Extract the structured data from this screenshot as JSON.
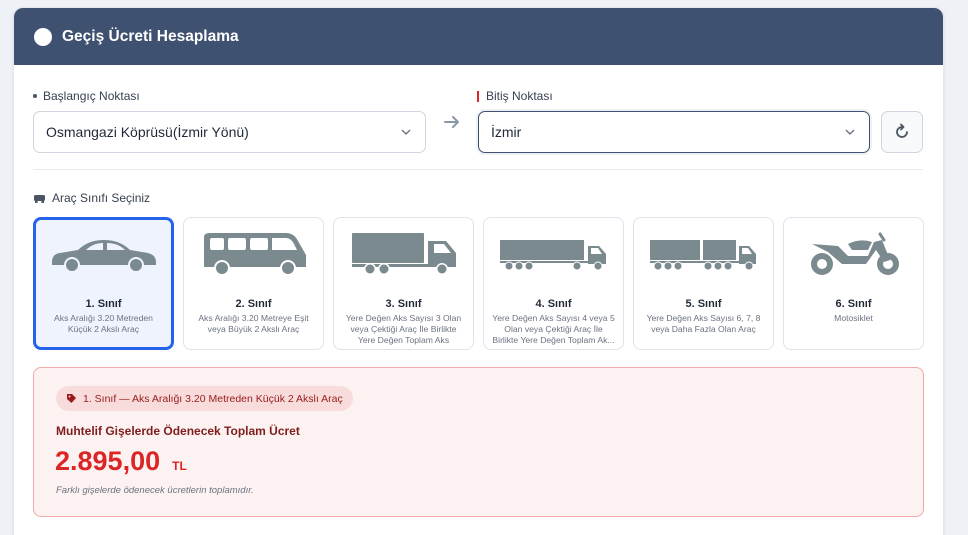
{
  "header": {
    "title": "Geçiş Ücreti Hesaplama"
  },
  "route": {
    "start_label": "Başlangıç Noktası",
    "start_value": "Osmangazi Köprüsü(İzmir Yönü)",
    "end_label": "Bitiş Noktası",
    "end_value": "İzmir"
  },
  "vehicle_section": {
    "label": "Araç Sınıfı Seçiniz"
  },
  "vehicles": [
    {
      "name": "1. Sınıf",
      "desc": "Aks Aralığı 3.20 Metreden Küçük 2 Akslı Araç",
      "icon": "car-icon"
    },
    {
      "name": "2. Sınıf",
      "desc": "Aks Aralığı 3.20 Metreye Eşit veya Büyük 2 Akslı Araç",
      "icon": "van-icon"
    },
    {
      "name": "3. Sınıf",
      "desc": "Yere Değen Aks Sayısı 3 Olan veya Çektiği Araç İle Birlikte Yere Değen Toplam Aks Sayısı...",
      "icon": "truck-icon"
    },
    {
      "name": "4. Sınıf",
      "desc": "Yere Değen Aks Sayısı 4 veya 5 Olan veya Çektiği Araç İle Birlikte Yere Değen Toplam Ak...",
      "icon": "semi-truck-icon"
    },
    {
      "name": "5. Sınıf",
      "desc": "Yere Değen Aks Sayısı 6, 7, 8 veya Daha Fazla Olan Araç",
      "icon": "long-truck-icon"
    },
    {
      "name": "6. Sınıf",
      "desc": "Motosiklet",
      "icon": "motorcycle-icon"
    }
  ],
  "result": {
    "badge": "1. Sınıf — Aks Aralığı 3.20 Metreden Küçük 2 Akslı Araç",
    "title": "Muhtelif Gişelerde Ödenecek Toplam Ücret",
    "amount": "2.895,00",
    "currency": "TL",
    "note": "Farklı gişelerde ödenecek ücretlerin toplamıdır."
  },
  "colors": {
    "header": "#3f5170",
    "accent": "#2563eb",
    "price": "#dc2626",
    "icon": "#7b8a8e"
  }
}
